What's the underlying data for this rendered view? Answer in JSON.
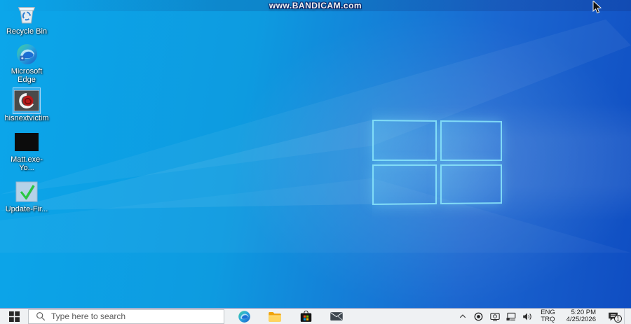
{
  "watermark": {
    "text": "www.BANDICAM.com"
  },
  "desktop": {
    "icons": [
      {
        "label": "Recycle Bin",
        "icon": "recycle-bin-icon",
        "selected": false
      },
      {
        "label": "Microsoft Edge",
        "icon": "edge-icon",
        "selected": false
      },
      {
        "label": "hisnextvictim",
        "icon": "hisnextvictim-thumbnail",
        "selected": true
      },
      {
        "label": "Matt.exe- Yo...",
        "icon": "video-thumbnail",
        "selected": false
      },
      {
        "label": "Update-Fir...",
        "icon": "checkmark-icon",
        "selected": false
      }
    ]
  },
  "taskbar": {
    "search_placeholder": "Type here to search",
    "apps": [
      {
        "name": "microsoft-edge"
      },
      {
        "name": "file-explorer"
      },
      {
        "name": "microsoft-store"
      },
      {
        "name": "mail"
      }
    ],
    "tray_icons": [
      "chevron-up",
      "record",
      "bandicam-device",
      "network",
      "volume"
    ],
    "language": {
      "top": "ENG",
      "bottom": "TRQ"
    },
    "clock": {
      "time": "5:20 PM",
      "date": "4/25/2026"
    },
    "notification_badge": "1"
  },
  "colors": {
    "desktop_gradient_left": "#0ca6ea",
    "desktop_gradient_right": "#0f4dc2",
    "taskbar_background": "#eff1f3",
    "selection_highlight": "#96c3f0",
    "store_red": "#f25022",
    "store_green": "#7fba00",
    "store_blue": "#00a4ef",
    "store_yellow": "#ffb900"
  }
}
